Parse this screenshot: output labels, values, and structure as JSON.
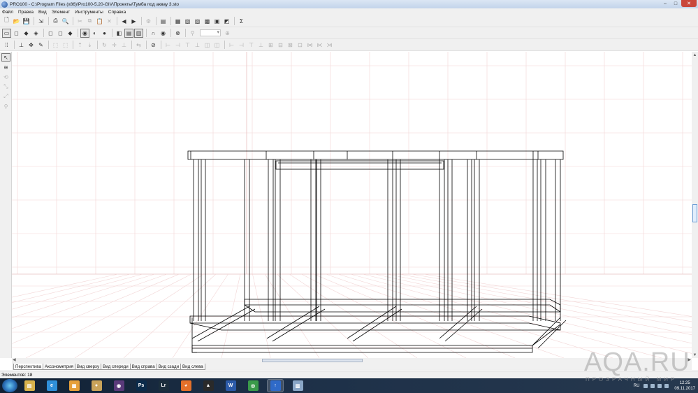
{
  "window": {
    "title": "PRO100 - C:\\Program Files (x86)\\Pro100-5.20-GIV\\Проекты\\Тумба под аквау 3.sto",
    "controls": {
      "minimize": "–",
      "maximize": "□",
      "close": "✕"
    }
  },
  "menu": [
    "Файл",
    "Правка",
    "Вид",
    "Элемент",
    "Инструменты",
    "Справка"
  ],
  "toolbar1": [
    {
      "name": "new-file-icon",
      "glyph": "🗋"
    },
    {
      "name": "open-icon",
      "glyph": "📂"
    },
    {
      "name": "save-icon",
      "glyph": "💾"
    },
    {
      "sep": true
    },
    {
      "name": "export-icon",
      "glyph": "⇲"
    },
    {
      "sep": true
    },
    {
      "name": "print-icon",
      "glyph": "⎙"
    },
    {
      "name": "print-preview-icon",
      "glyph": "🔍"
    },
    {
      "sep": true
    },
    {
      "name": "cut-icon",
      "glyph": "✂",
      "dim": true
    },
    {
      "name": "copy-icon",
      "glyph": "⧉",
      "dim": true
    },
    {
      "name": "paste-icon",
      "glyph": "📋",
      "dim": true
    },
    {
      "name": "delete-icon",
      "glyph": "✕",
      "dim": true
    },
    {
      "sep": true
    },
    {
      "name": "undo-icon",
      "glyph": "◀"
    },
    {
      "name": "redo-icon",
      "glyph": "▶"
    },
    {
      "sep": true
    },
    {
      "name": "properties-icon",
      "glyph": "⚙",
      "dim": true
    },
    {
      "sep": true
    },
    {
      "name": "project-properties-icon",
      "glyph": "▤"
    },
    {
      "sep": true
    },
    {
      "name": "report-icon",
      "glyph": "▦"
    },
    {
      "name": "report-parts-icon",
      "glyph": "▧"
    },
    {
      "name": "report-cut-icon",
      "glyph": "▨"
    },
    {
      "name": "report-print-icon",
      "glyph": "▩"
    },
    {
      "name": "report-export-icon",
      "glyph": "▣"
    },
    {
      "name": "report-settings-icon",
      "glyph": "◩"
    },
    {
      "sep": true
    },
    {
      "name": "sum-icon",
      "glyph": "Σ"
    }
  ],
  "toolbar2": [
    {
      "name": "view-frame-icon",
      "glyph": "▭",
      "active": true
    },
    {
      "name": "view-icon-2",
      "glyph": "◻"
    },
    {
      "name": "view-icon-3",
      "glyph": "◆"
    },
    {
      "name": "view-icon-4",
      "glyph": "◈"
    },
    {
      "sep": true
    },
    {
      "name": "view-icon-5",
      "glyph": "◻"
    },
    {
      "name": "view-icon-6",
      "glyph": "◻"
    },
    {
      "name": "view-icon-7",
      "glyph": "◆"
    },
    {
      "sep": true
    },
    {
      "name": "camera-icon",
      "glyph": "◉",
      "active": true
    },
    {
      "name": "light-icon",
      "glyph": "◐"
    },
    {
      "name": "bulb-icon",
      "glyph": "●"
    },
    {
      "sep": true
    },
    {
      "name": "materials-icon",
      "glyph": "◧"
    },
    {
      "name": "wireframe-icon",
      "glyph": "▤",
      "active": true
    },
    {
      "name": "solid-icon",
      "glyph": "▥",
      "active": true
    },
    {
      "sep": true
    },
    {
      "name": "magnet-icon",
      "glyph": "∩"
    },
    {
      "name": "snap-icon",
      "glyph": "◉"
    },
    {
      "sep": true
    },
    {
      "name": "stop-icon",
      "glyph": "⊗"
    },
    {
      "sep": true
    },
    {
      "name": "zoom-icon",
      "glyph": "⚲",
      "dim": true
    },
    {
      "combo": true
    },
    {
      "name": "zoom-plus-icon",
      "glyph": "⊕",
      "dim": true
    }
  ],
  "toolbar3": [
    {
      "name": "grid-icon",
      "glyph": "⁞⁞"
    },
    {
      "sep": true
    },
    {
      "name": "arrange-icon",
      "glyph": "⊥"
    },
    {
      "name": "move-icon",
      "glyph": "✥"
    },
    {
      "name": "edit-icon",
      "glyph": "✎"
    },
    {
      "sep": true
    },
    {
      "name": "group-icon",
      "glyph": "⬚",
      "dim": true
    },
    {
      "name": "ungroup-icon",
      "glyph": "⬚",
      "dim": true
    },
    {
      "sep": true
    },
    {
      "name": "up-icon",
      "glyph": "⇡",
      "dim": true
    },
    {
      "name": "down-icon",
      "glyph": "⇣",
      "dim": true
    },
    {
      "sep": true
    },
    {
      "name": "rotate-icon",
      "glyph": "↻",
      "dim": true
    },
    {
      "name": "move-cross-icon",
      "glyph": "✛",
      "dim": true
    },
    {
      "name": "level-icon",
      "glyph": "⊥",
      "dim": true
    },
    {
      "sep": true
    },
    {
      "name": "mirror-icon",
      "glyph": "⇆",
      "dim": true
    },
    {
      "sep": true
    },
    {
      "name": "lock-icon",
      "glyph": "⊘"
    },
    {
      "sep": true
    },
    {
      "name": "align-1-icon",
      "glyph": "⊢",
      "dim": true
    },
    {
      "name": "align-2-icon",
      "glyph": "⊣",
      "dim": true
    },
    {
      "name": "align-3-icon",
      "glyph": "⊤",
      "dim": true
    },
    {
      "name": "align-4-icon",
      "glyph": "⊥",
      "dim": true
    },
    {
      "name": "align-5-icon",
      "glyph": "◫",
      "dim": true
    },
    {
      "name": "align-6-icon",
      "glyph": "◫",
      "dim": true
    },
    {
      "sep": true
    },
    {
      "name": "dist-1-icon",
      "glyph": "⊢",
      "dim": true
    },
    {
      "name": "dist-2-icon",
      "glyph": "⊣",
      "dim": true
    },
    {
      "name": "dist-3-icon",
      "glyph": "⊤",
      "dim": true
    },
    {
      "name": "dist-4-icon",
      "glyph": "⊥",
      "dim": true
    },
    {
      "name": "dist-5-icon",
      "glyph": "⊞",
      "dim": true
    },
    {
      "name": "dist-6-icon",
      "glyph": "⊟",
      "dim": true
    },
    {
      "name": "dist-7-icon",
      "glyph": "⊠",
      "dim": true
    },
    {
      "name": "dist-8-icon",
      "glyph": "⊡",
      "dim": true
    },
    {
      "name": "dist-9-icon",
      "glyph": "⋈",
      "dim": true
    },
    {
      "name": "dist-10-icon",
      "glyph": "⋉",
      "dim": true
    },
    {
      "name": "dist-11-icon",
      "glyph": "⋊",
      "dim": true
    }
  ],
  "left_tools": [
    {
      "name": "select-tool-icon",
      "glyph": "↖",
      "active": true
    },
    {
      "name": "spring-tool-icon",
      "glyph": "≋"
    },
    {
      "name": "rotate-tool-icon",
      "glyph": "⟲",
      "dim": true
    },
    {
      "name": "resize-tool-icon",
      "glyph": "⤡",
      "dim": true
    },
    {
      "name": "stretch-tool-icon",
      "glyph": "⤢",
      "dim": true
    },
    {
      "name": "zoom-tool-icon",
      "glyph": "⚲",
      "dim": true
    }
  ],
  "view_tabs": [
    "Перспектива",
    "Аксонометрия",
    "Вид сверху",
    "Вид спереди",
    "Вид справа",
    "Вид сзади",
    "Вид слева"
  ],
  "active_view_tab": "Перспектива",
  "status": {
    "elements": "Элементов: 18"
  },
  "taskbar": {
    "apps": [
      {
        "name": "explorer-taskbar-icon",
        "label": "▤",
        "color": "#d7b24c"
      },
      {
        "name": "ie-taskbar-icon",
        "label": "e",
        "color": "#2f8fd8"
      },
      {
        "name": "paint-taskbar-icon",
        "label": "▦",
        "color": "#e6a03a"
      },
      {
        "name": "cookie-taskbar-icon",
        "label": "●",
        "color": "#c9a35a"
      },
      {
        "name": "davinci-taskbar-icon",
        "label": "◉",
        "color": "#5a3a7a"
      },
      {
        "name": "photoshop-taskbar-icon",
        "label": "Ps",
        "color": "#0b2b4a"
      },
      {
        "name": "lightroom-taskbar-icon",
        "label": "Lr",
        "color": "#1b2e3c"
      },
      {
        "name": "firefox-taskbar-icon",
        "label": "◕",
        "color": "#e4702a"
      },
      {
        "name": "autocad-taskbar-icon",
        "label": "▲",
        "color": "#2a2a2a"
      },
      {
        "name": "word-taskbar-icon",
        "label": "W",
        "color": "#2b5aa8"
      },
      {
        "name": "chrome-taskbar-icon",
        "label": "◎",
        "color": "#3a9a4a"
      },
      {
        "name": "pro100-taskbar-icon",
        "label": "↑",
        "color": "#2f6ac8",
        "running": true
      },
      {
        "name": "notes-taskbar-icon",
        "label": "▥",
        "color": "#8aa6c6"
      }
    ],
    "language": "RU",
    "time": "12:25",
    "date": "09.11.2017"
  },
  "watermark": {
    "main": "AQA.RU",
    "sub": "ПРОЗРАЧНЫЙ МИР"
  }
}
